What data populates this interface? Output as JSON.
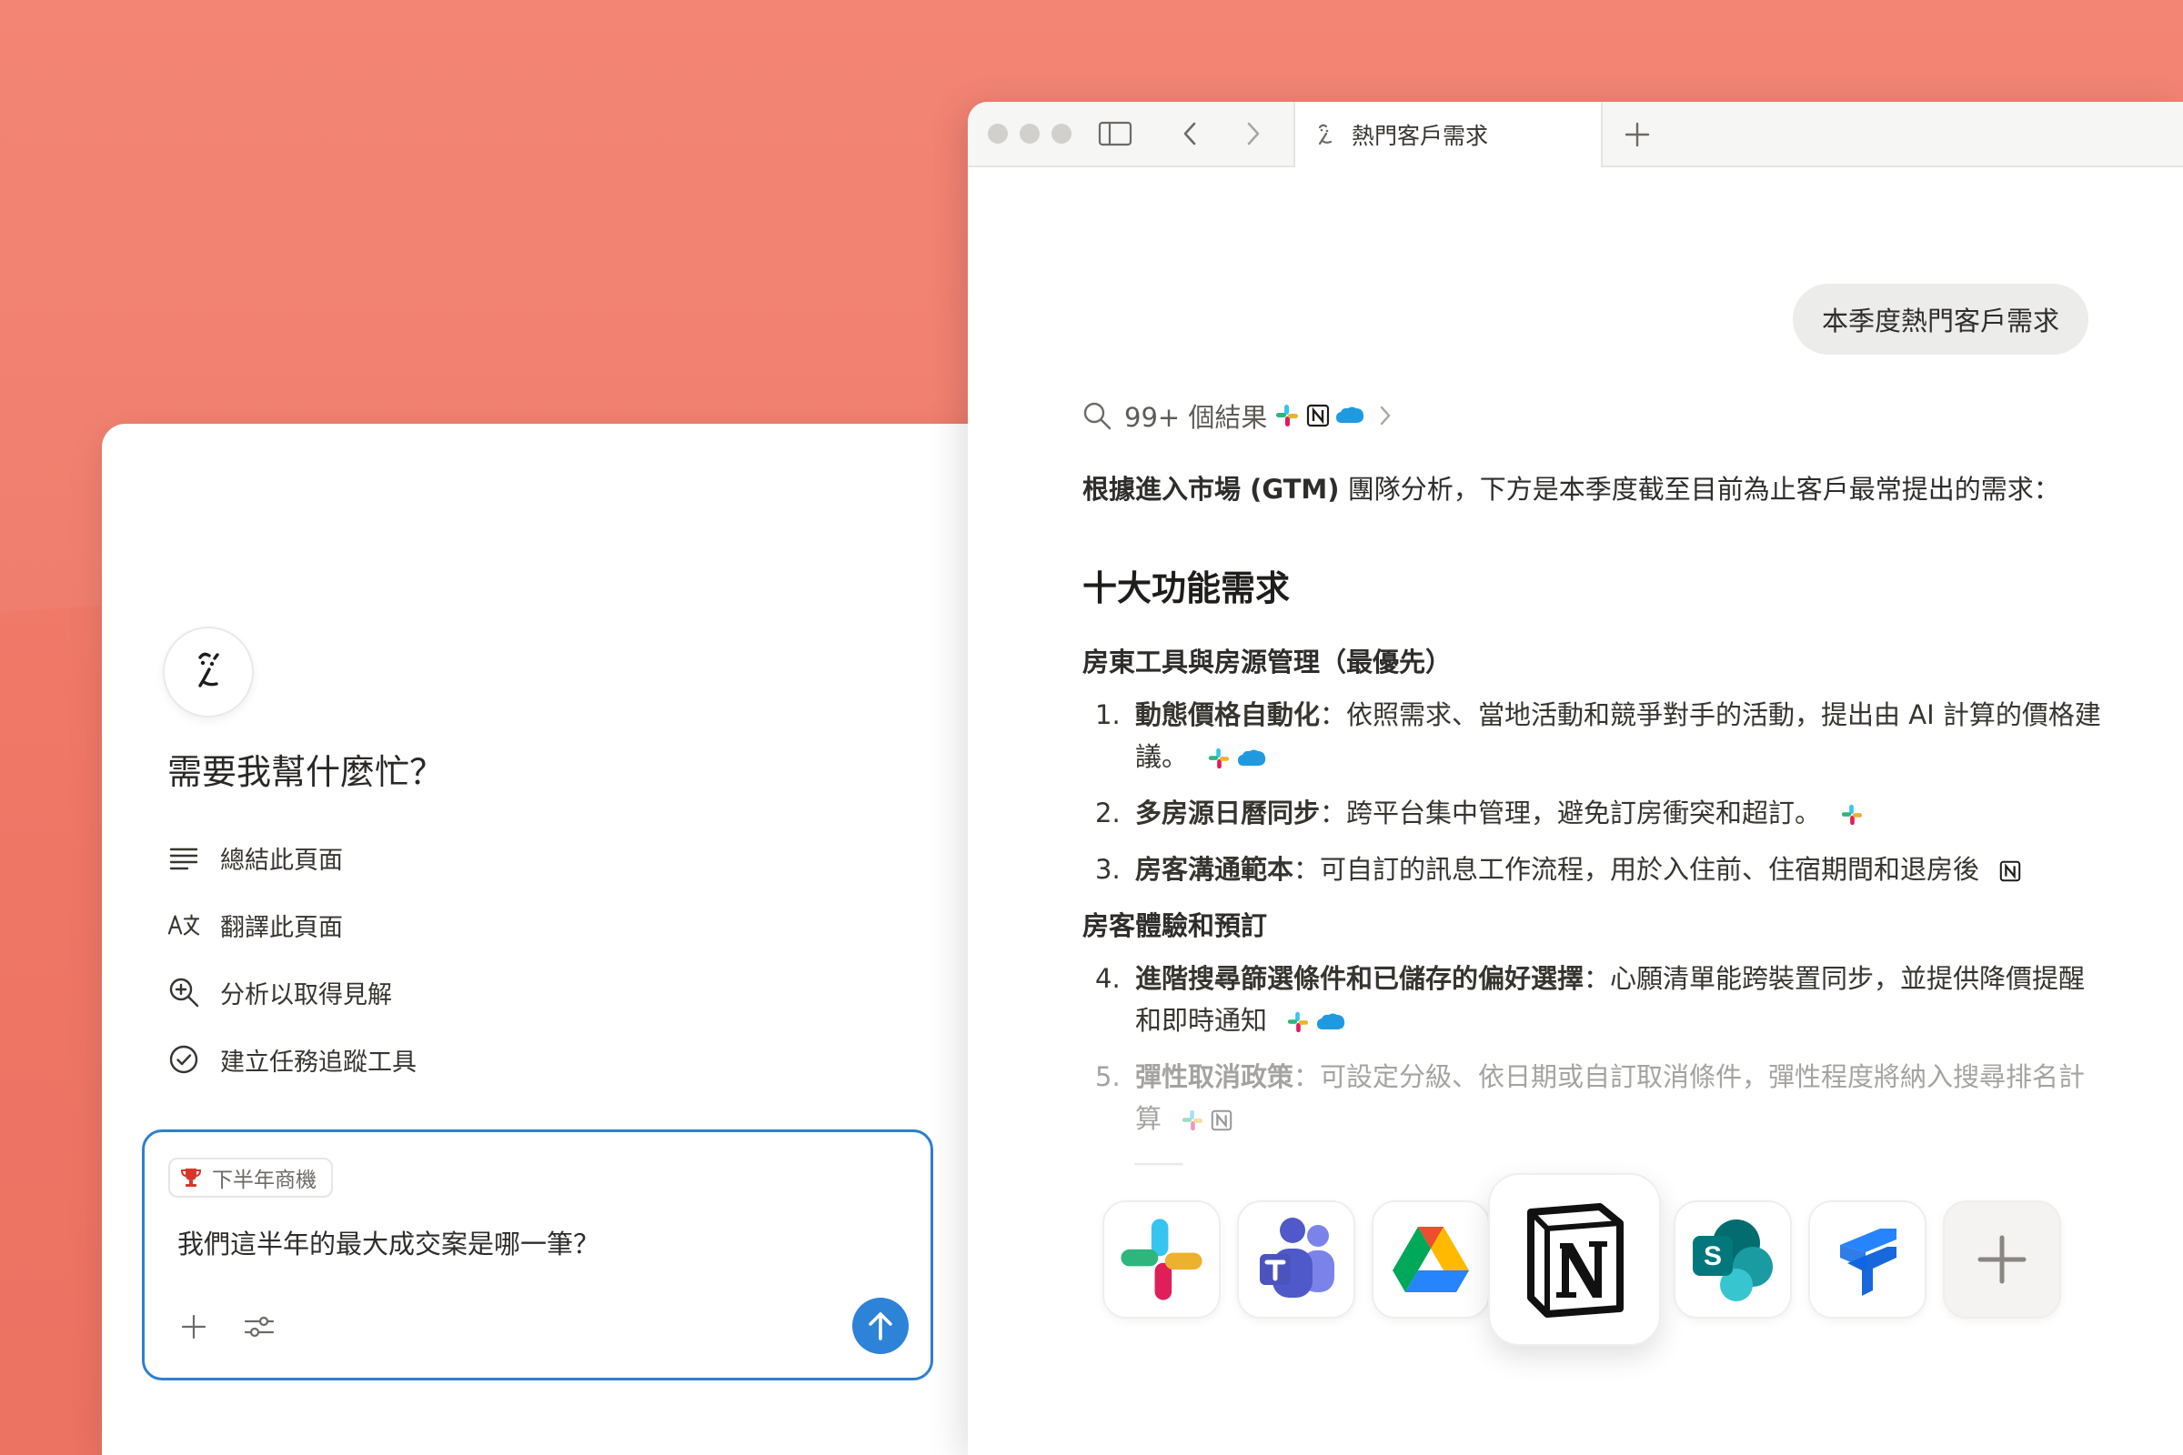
{
  "ai_panel": {
    "title": "需要我幫什麼忙？",
    "actions": [
      {
        "label": "總結此頁面",
        "icon": "lines-icon"
      },
      {
        "label": "翻譯此頁面",
        "icon": "translate-icon"
      },
      {
        "label": "分析以取得見解",
        "icon": "magnify-plus-icon"
      },
      {
        "label": "建立任務追蹤工具",
        "icon": "check-circle-icon"
      }
    ],
    "composer": {
      "chip_label": "下半年商機",
      "text": "我們這半年的最大成交案是哪一筆？"
    }
  },
  "browser": {
    "tab_title": "熱門客戶需求",
    "query": "本季度熱門客戶需求",
    "results_label": "99+ 個結果",
    "intro_bold": "根據進入市場 (GTM)",
    "intro_rest": " 團隊分析，下方是本季度截至目前為止客戶最常提出的需求：",
    "heading": "十大功能需求",
    "sections": [
      {
        "title": "房東工具與房源管理（最優先）",
        "items": [
          {
            "num": "1.",
            "title": "動態價格自動化",
            "desc": "：依照需求、當地活動和競爭對手的活動，提出由 AI 計算的價格建議。"
          },
          {
            "num": "2.",
            "title": "多房源日曆同步",
            "desc": "：跨平台集中管理，避免訂房衝突和超訂。"
          },
          {
            "num": "3.",
            "title": "房客溝通範本",
            "desc": "：可自訂的訊息工作流程，用於入住前、住宿期間和退房後"
          }
        ]
      },
      {
        "title": "房客體驗和預訂",
        "items": [
          {
            "num": "4.",
            "title": "進階搜尋篩選條件和已儲存的偏好選擇",
            "desc": "：心願清單能跨裝置同步，並提供降價提醒和即時通知"
          },
          {
            "num": "5.",
            "title": "彈性取消政策",
            "desc": "：可設定分級、依日期或自訂取消條件，彈性程度將納入搜尋排名計算"
          }
        ]
      }
    ]
  },
  "colors": {
    "background": "#f07a6b",
    "accent_blue": "#2c83d7",
    "bubble_gray": "#ececea"
  },
  "integrations": [
    "slack-icon",
    "teams-icon",
    "google-drive-icon",
    "notion-icon",
    "sharepoint-icon",
    "jira-icon",
    "add-icon"
  ]
}
